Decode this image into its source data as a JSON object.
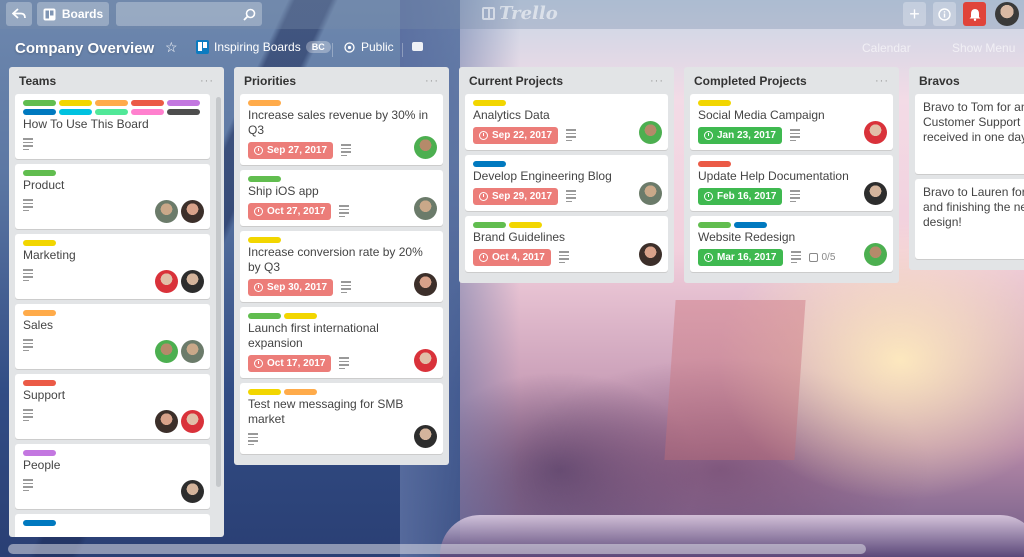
{
  "header": {
    "back_icon": "back-arrow-icon",
    "boards_label": "Boards",
    "search_placeholder": "",
    "logo_text": "Trello",
    "add_icon": "+",
    "info_icon": "ⓘ",
    "bell_icon": "🔔"
  },
  "board": {
    "title": "Company Overview",
    "star_icon": "☆",
    "team_name": "Inspiring Boards",
    "team_badge": "BC",
    "visibility": "Public",
    "right_menu": [
      "Calendar",
      "Show Menu"
    ]
  },
  "colors": {
    "green": "#61bd4f",
    "yellow": "#f2d600",
    "orange": "#ffab4a",
    "red": "#eb5a46",
    "purple": "#c377e0",
    "blue": "#0079bf",
    "sky": "#00c2e0",
    "lime": "#51e898",
    "pink": "#ff80ce",
    "black": "#4d4d4d",
    "due_overdue": "#ec7d79",
    "due_complete": "#3fb950"
  },
  "lists": [
    {
      "title": "Teams",
      "menu": "···",
      "cards": [
        {
          "title": "How To Use This Board",
          "labels": [
            "green",
            "yellow",
            "orange",
            "red",
            "purple",
            "blue",
            "sky",
            "lime",
            "pink",
            "black"
          ],
          "members": 0
        },
        {
          "title": "Product",
          "labels": [
            "green"
          ],
          "members": 2
        },
        {
          "title": "Marketing",
          "labels": [
            "yellow"
          ],
          "members": 2
        },
        {
          "title": "Sales",
          "labels": [
            "orange"
          ],
          "members": 2
        },
        {
          "title": "Support",
          "labels": [
            "red"
          ],
          "members": 2
        },
        {
          "title": "People",
          "labels": [
            "purple"
          ],
          "members": 1
        },
        {
          "title": "",
          "labels": [
            "blue"
          ],
          "members": 0
        }
      ]
    },
    {
      "title": "Priorities",
      "menu": "···",
      "cards": [
        {
          "title": "Increase sales revenue by 30% in Q3",
          "labels": [
            "orange"
          ],
          "due": "Sep 27, 2017",
          "due_status": "overdue",
          "members": 1
        },
        {
          "title": "Ship iOS app",
          "labels": [
            "green"
          ],
          "due": "Oct 27, 2017",
          "due_status": "overdue",
          "members": 1
        },
        {
          "title": "Increase conversion rate by 20% by Q3",
          "labels": [
            "yellow"
          ],
          "due": "Sep 30, 2017",
          "due_status": "overdue",
          "members": 1
        },
        {
          "title": "Launch first international expansion",
          "labels": [
            "green",
            "yellow"
          ],
          "due": "Oct 17, 2017",
          "due_status": "overdue",
          "members": 1
        },
        {
          "title": "Test new messaging for SMB market",
          "labels": [
            "yellow",
            "orange"
          ],
          "members": 1
        }
      ]
    },
    {
      "title": "Current Projects",
      "menu": "···",
      "cards": [
        {
          "title": "Analytics Data",
          "labels": [
            "yellow"
          ],
          "due": "Sep 22, 2017",
          "due_status": "overdue",
          "members": 1
        },
        {
          "title": "Develop Engineering Blog",
          "labels": [
            "blue"
          ],
          "due": "Sep 29, 2017",
          "due_status": "overdue",
          "members": 1
        },
        {
          "title": "Brand Guidelines",
          "labels": [
            "green",
            "yellow"
          ],
          "due": "Oct 4, 2017",
          "due_status": "overdue",
          "members": 1
        }
      ]
    },
    {
      "title": "Completed Projects",
      "menu": "···",
      "cards": [
        {
          "title": "Social Media Campaign",
          "labels": [
            "yellow"
          ],
          "due": "Jan 23, 2017",
          "due_status": "complete",
          "members": 1
        },
        {
          "title": "Update Help Documentation",
          "labels": [
            "red"
          ],
          "due": "Feb 16, 2017",
          "due_status": "complete",
          "members": 1
        },
        {
          "title": "Website Redesign",
          "labels": [
            "green",
            "blue"
          ],
          "due": "Mar 16, 2017",
          "due_status": "complete",
          "checklist": "0/5",
          "members": 1
        }
      ]
    },
    {
      "title": "Bravos",
      "cards": [
        {
          "lines": [
            "Bravo to Tom for ans",
            "Customer Support e",
            "received in one day!"
          ]
        },
        {
          "lines": [
            "Bravo to Lauren for t",
            "and finishing the nev",
            "design!"
          ]
        }
      ]
    }
  ]
}
